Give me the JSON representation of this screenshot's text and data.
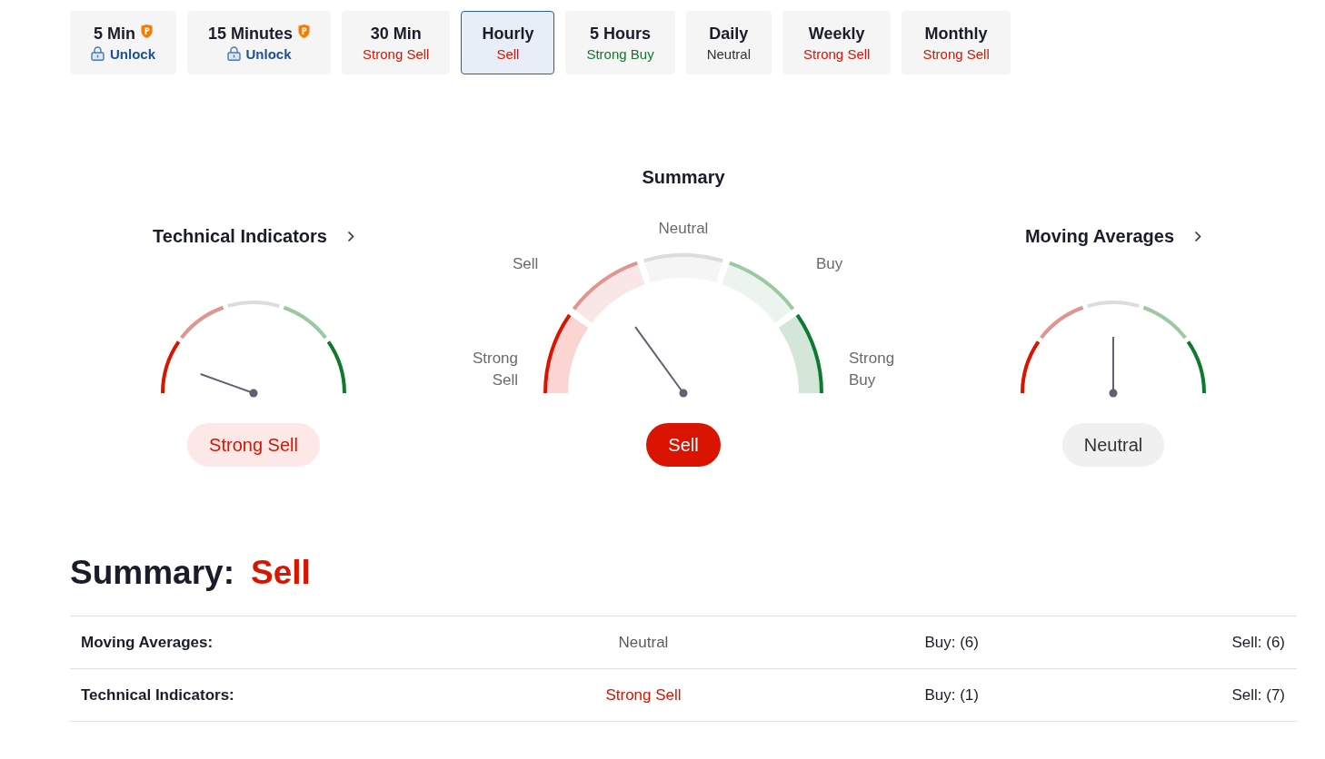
{
  "tabs": [
    {
      "title": "5 Min",
      "status": "Unlock",
      "locked": true,
      "selected": false
    },
    {
      "title": "15 Minutes",
      "status": "Unlock",
      "locked": true,
      "selected": false
    },
    {
      "title": "30 Min",
      "status": "Strong Sell",
      "kind": "strong_sell",
      "locked": false,
      "selected": false
    },
    {
      "title": "Hourly",
      "status": "Sell",
      "kind": "sell",
      "locked": false,
      "selected": true
    },
    {
      "title": "5 Hours",
      "status": "Strong Buy",
      "kind": "strong_buy",
      "locked": false,
      "selected": false
    },
    {
      "title": "Daily",
      "status": "Neutral",
      "kind": "neutral",
      "locked": false,
      "selected": false
    },
    {
      "title": "Weekly",
      "status": "Strong Sell",
      "kind": "strong_sell",
      "locked": false,
      "selected": false
    },
    {
      "title": "Monthly",
      "status": "Strong Sell",
      "kind": "strong_sell",
      "locked": false,
      "selected": false
    }
  ],
  "gauges": [
    {
      "main": false,
      "title": "Technical Indicators",
      "result": "Strong Sell",
      "kind": "strong_sell"
    },
    {
      "main": true,
      "title": "Summary",
      "result": "Sell",
      "kind": "sell",
      "scale_labels": [
        "Strong Sell",
        "Sell",
        "Neutral",
        "Buy",
        "Strong Buy"
      ]
    },
    {
      "main": false,
      "title": "Moving Averages",
      "result": "Neutral",
      "kind": "neutral"
    }
  ],
  "summary": {
    "label": "Summary:",
    "value": "Sell",
    "kind": "sell"
  },
  "table": {
    "rows": [
      {
        "label": "Moving Averages:",
        "value": "Neutral",
        "kind": "neutral",
        "buy": "Buy: (6)",
        "sell": "Sell: (6)"
      },
      {
        "label": "Technical Indicators:",
        "value": "Strong Sell",
        "kind": "strong_sell",
        "buy": "Buy: (1)",
        "sell": "Sell: (7)"
      }
    ]
  }
}
